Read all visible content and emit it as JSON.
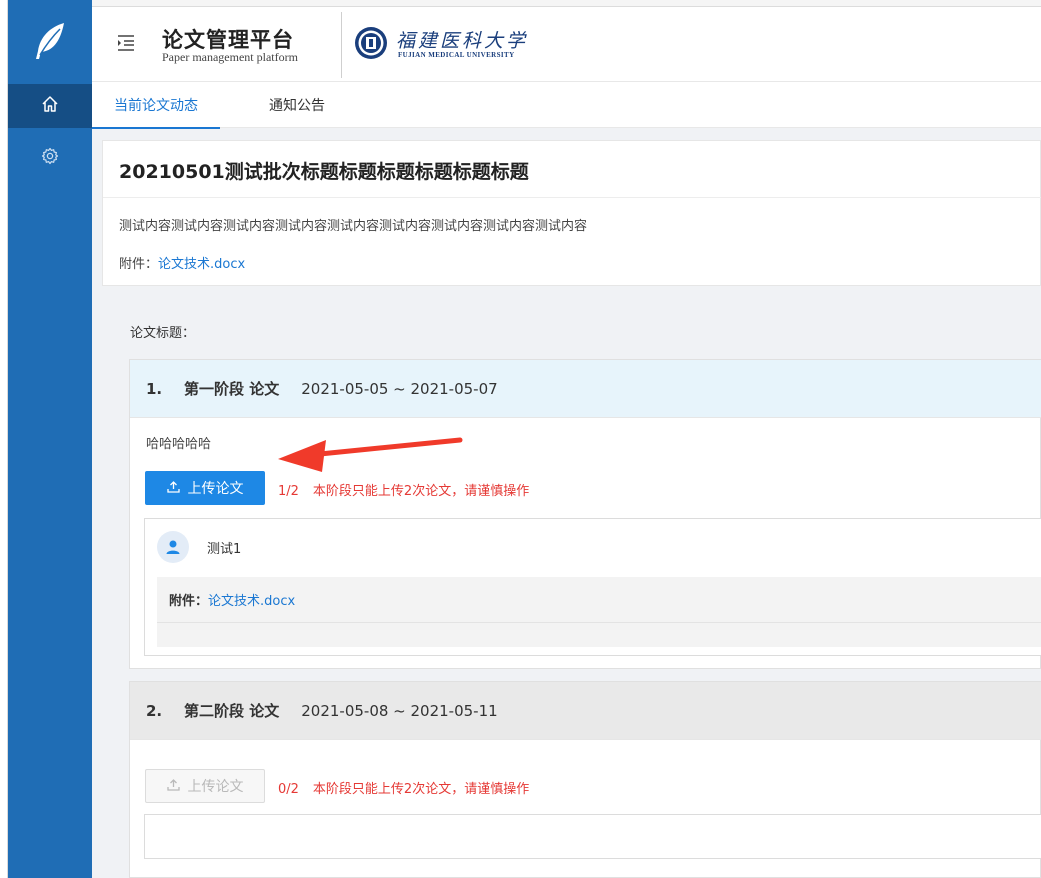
{
  "header": {
    "title": "论文管理平台",
    "subtitle": "Paper management platform",
    "university_cn": "福建医科大学",
    "university_en": "FUJIAN MEDICAL UNIVERSITY"
  },
  "tabs": [
    {
      "label": "当前论文动态",
      "active": true
    },
    {
      "label": "通知公告",
      "active": false
    }
  ],
  "batch": {
    "title": "20210501测试批次标题标题标题标题标题标题",
    "content": "测试内容测试内容测试内容测试内容测试内容测试内容测试内容测试内容测试内容",
    "attachment_label": "附件：",
    "attachment_file": "论文技术.docx"
  },
  "paper_title_label": "论文标题：",
  "stages": [
    {
      "num": "1.",
      "name": "第一阶段 论文",
      "date_range": "2021-05-05 ~ 2021-05-07",
      "description": "哈哈哈哈哈",
      "upload_label": "上传论文",
      "count": "1/2",
      "hint": "本阶段只能上传2次论文，请谨慎操作",
      "submission": {
        "user": "测试1",
        "attachment_label": "附件：",
        "attachment_file": "论文技术.docx"
      }
    },
    {
      "num": "2.",
      "name": "第二阶段 论文",
      "date_range": "2021-05-08 ~ 2021-05-11",
      "upload_label": "上传论文",
      "count": "0/2",
      "hint": "本阶段只能上传2次论文，请谨慎操作"
    }
  ],
  "colors": {
    "sidebar": "#1f6db5",
    "sidebar_active": "#154e85",
    "accent": "#1a77d2",
    "button": "#1e88e5",
    "warning_text": "#e53935",
    "stage1_head": "#e7f4fb",
    "stage2_head": "#e9e9e9"
  },
  "icons": [
    "feather-logo-icon",
    "home-icon",
    "gear-icon",
    "menu-fold-icon",
    "university-seal-icon",
    "upload-icon",
    "user-icon",
    "red-arrow-annotation"
  ]
}
